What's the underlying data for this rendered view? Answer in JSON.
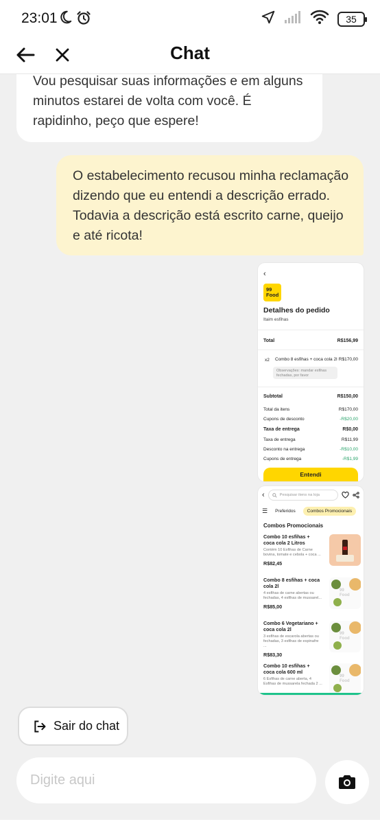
{
  "status_bar": {
    "time": "23:01",
    "battery": "35"
  },
  "header": {
    "title": "Chat"
  },
  "messages": {
    "incoming_text": "Vou pesquisar suas informações e em alguns minutos estarei de volta com você. É rapidinho, peço que espere!",
    "outgoing_text": "O estabelecimento recusou minha reclamação dizendo que eu entendi a descrição errado. Todavia a descrição está escrito carne, queijo e até ricota!"
  },
  "order_screenshot": {
    "logo": "99 Food",
    "title": "Detalhes do pedido",
    "store": "Itaim esfihas",
    "total_label": "Total",
    "total_value": "R$156,99",
    "qty": "x2",
    "item_name": "Combo 8 esfihas + coca cola 2l",
    "item_price": "R$170,00",
    "note": "Observações: mandar esfihas fechadas, por favor",
    "subtotal_label": "Subtotal",
    "subtotal_value": "R$150,00",
    "rows": [
      {
        "label": "Total da itens",
        "value": "R$170,00",
        "bold": false,
        "green": false
      },
      {
        "label": "Cupons de desconto",
        "value": "-R$20,00",
        "bold": false,
        "green": true
      },
      {
        "label": "Taxa de entrega",
        "value": "R$0,00",
        "bold": true,
        "green": false
      },
      {
        "label": "Taxa de entrega",
        "value": "R$11,99",
        "bold": false,
        "green": false
      },
      {
        "label": "Desconto na entrega",
        "value": "-R$10,00",
        "bold": false,
        "green": true
      },
      {
        "label": "Cupons de entrega",
        "value": "-R$1,99",
        "bold": false,
        "green": true
      }
    ],
    "button": "Entendi"
  },
  "menu_screenshot": {
    "search_placeholder": "Pesquisar itens na loja",
    "tab_favorites": "Preferidos",
    "tab_combos": "Combos Promocionais",
    "section": "Combos Promocionais",
    "image_watermark": "99 Food",
    "products": [
      {
        "name": "Combo 10 esfihas + coca cola 2 Litros",
        "desc": "Contém 10 Esfihas de Carne bovina, tomate e cebola + coca ...",
        "price": "R$82,45"
      },
      {
        "name": "Combo 8 esfihas + coca cola 2l",
        "desc": "4 esfihas de carne abertas ou fechadas, 4 esfihas de mussarel...",
        "price": "R$85,00"
      },
      {
        "name": "Combo 6 Vegetariano + coca cola 2l",
        "desc": "3 esfihas de escarola abertas ou fechadas, 3 esfihas de espinafre ...",
        "price": "R$83,30"
      },
      {
        "name": "Combo 10 esfihas + coca cola 600 ml",
        "desc": "6 Esfihas de carne aberta, 4 Esfihas de mussarela fechada 2 ...",
        "price": ""
      }
    ]
  },
  "exit_chat": {
    "label": "Sair do chat"
  },
  "composer": {
    "placeholder": "Digite aqui"
  }
}
